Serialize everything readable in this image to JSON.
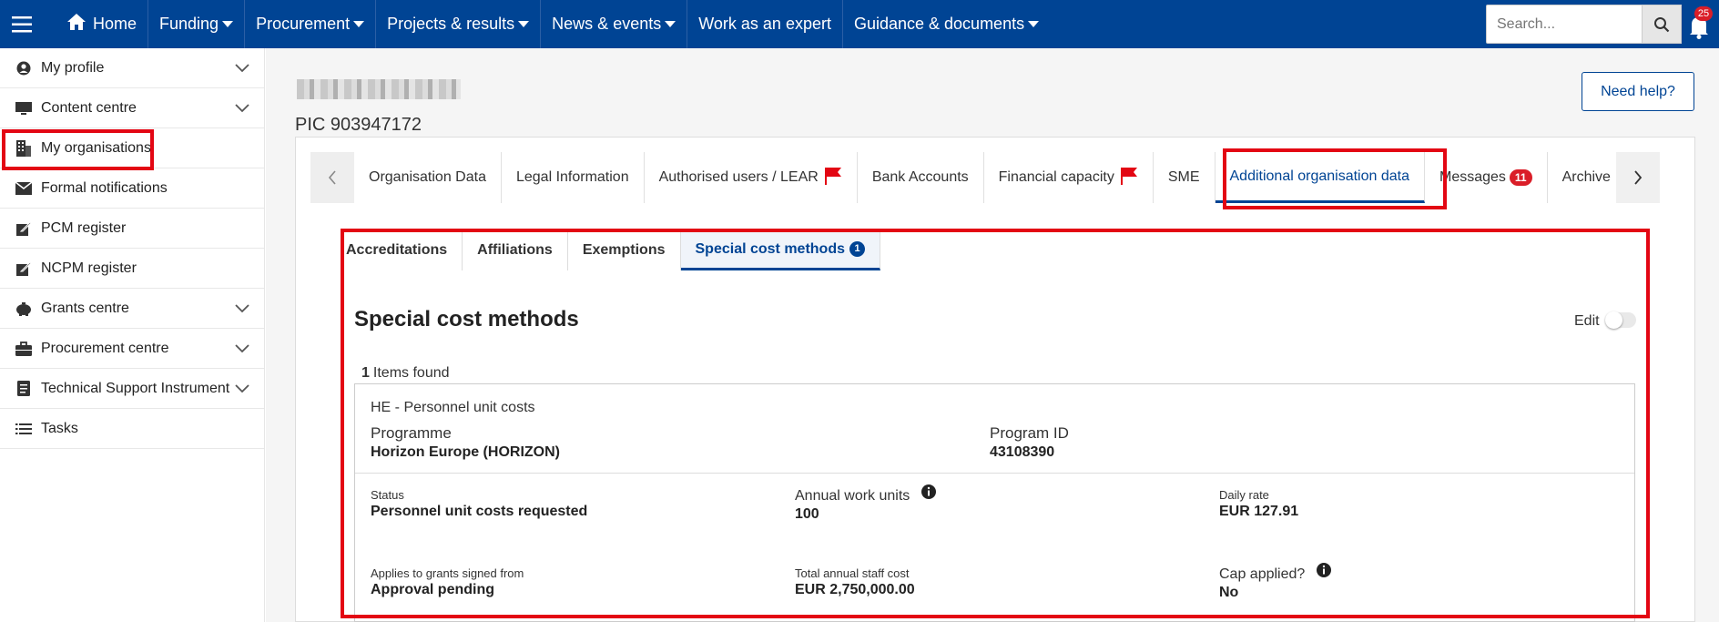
{
  "topbar": {
    "nav": [
      {
        "label": "Home",
        "caret": false
      },
      {
        "label": "Funding",
        "caret": true
      },
      {
        "label": "Procurement",
        "caret": true
      },
      {
        "label": "Projects & results",
        "caret": true
      },
      {
        "label": "News & events",
        "caret": true
      },
      {
        "label": "Work as an expert",
        "caret": false
      },
      {
        "label": "Guidance & documents",
        "caret": true
      }
    ],
    "search_placeholder": "Search...",
    "notification_count": "25",
    "bg_color": "#004494"
  },
  "sidebar": {
    "items": [
      {
        "label": "My profile",
        "icon": "user-icon"
      },
      {
        "label": "Content centre",
        "icon": "monitor-icon"
      },
      {
        "label": "My organisations",
        "icon": "building-icon"
      },
      {
        "label": "Formal notifications",
        "icon": "envelope-icon"
      },
      {
        "label": "PCM register",
        "icon": "edit-icon"
      },
      {
        "label": "NCPM register",
        "icon": "edit-icon"
      },
      {
        "label": "Grants centre",
        "icon": "piggy-bank-icon"
      },
      {
        "label": "Procurement centre",
        "icon": "briefcase-icon"
      },
      {
        "label": "Technical Support Instrument",
        "icon": "document-icon"
      },
      {
        "label": "Tasks",
        "icon": "list-icon"
      }
    ]
  },
  "header": {
    "pic": "PIC 903947172",
    "help_label": "Need help?"
  },
  "tabs": {
    "items": [
      {
        "label": "Organisation Data"
      },
      {
        "label": "Legal Information"
      },
      {
        "label": "Authorised users / LEAR"
      },
      {
        "label": "Bank Accounts"
      },
      {
        "label": "Financial capacity"
      },
      {
        "label": "SME"
      },
      {
        "label": "Additional organisation data"
      },
      {
        "label": "Messages"
      },
      {
        "label": "Archive"
      }
    ],
    "messages_count": "11"
  },
  "subtabs": {
    "items": [
      {
        "label": "Accreditations"
      },
      {
        "label": "Affiliations"
      },
      {
        "label": "Exemptions"
      },
      {
        "label": "Special cost methods"
      }
    ],
    "active_count": "1"
  },
  "section": {
    "title": "Special cost methods",
    "edit_label": "Edit",
    "items_count": "1",
    "items_found_label": "Items found"
  },
  "card": {
    "title": "HE - Personnel unit costs",
    "programme_label": "Programme",
    "programme_value": "Horizon Europe (HORIZON)",
    "program_id_label": "Program ID",
    "program_id_value": "43108390",
    "status_label": "Status",
    "status_value": "Personnel unit costs requested",
    "annual_work_units_label": "Annual work units",
    "annual_work_units_value": "100",
    "daily_rate_label": "Daily rate",
    "daily_rate_value": "EUR 127.91",
    "applies_label": "Applies to grants signed from",
    "applies_value": "Approval pending",
    "total_cost_label": "Total annual staff cost",
    "total_cost_value": "EUR 2,750,000.00",
    "cap_label": "Cap applied?",
    "cap_value": "No"
  },
  "colors": {
    "accent": "#004494",
    "highlight": "#e30613",
    "badge": "#da1e28"
  }
}
